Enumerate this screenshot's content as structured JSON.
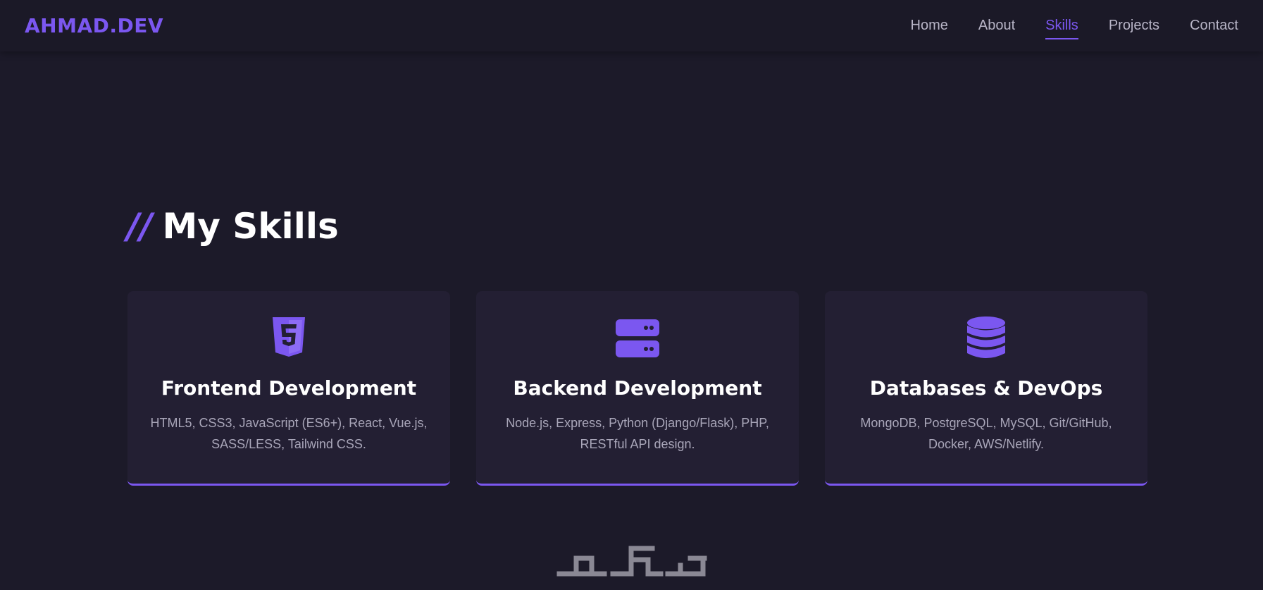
{
  "nav": {
    "logo": "AHMAD.DEV",
    "links": [
      {
        "label": "Home"
      },
      {
        "label": "About"
      },
      {
        "label": "Skills"
      },
      {
        "label": "Projects"
      },
      {
        "label": "Contact"
      }
    ],
    "active": "Skills"
  },
  "skills": {
    "title_prefix": "//",
    "title": "My Skills",
    "cards": [
      {
        "icon": "html5-icon",
        "title": "Frontend Development",
        "desc": "HTML5, CSS3, JavaScript (ES6+), React, Vue.js, SASS/LESS, Tailwind CSS."
      },
      {
        "icon": "server-icon",
        "title": "Backend Development",
        "desc": "Node.js, Express, Python (Django/Flask), PHP, RESTful API design."
      },
      {
        "icon": "database-icon",
        "title": "Databases & DevOps",
        "desc": "MongoDB, PostgreSQL, MySQL, Git/GitHub, Docker, AWS/Netlify."
      }
    ]
  },
  "watermark": {
    "text": "خمسات"
  },
  "colors": {
    "accent": "#7b57f0",
    "background": "#1c1a29",
    "card": "#231f33",
    "muted_text": "#a9a6b9"
  }
}
